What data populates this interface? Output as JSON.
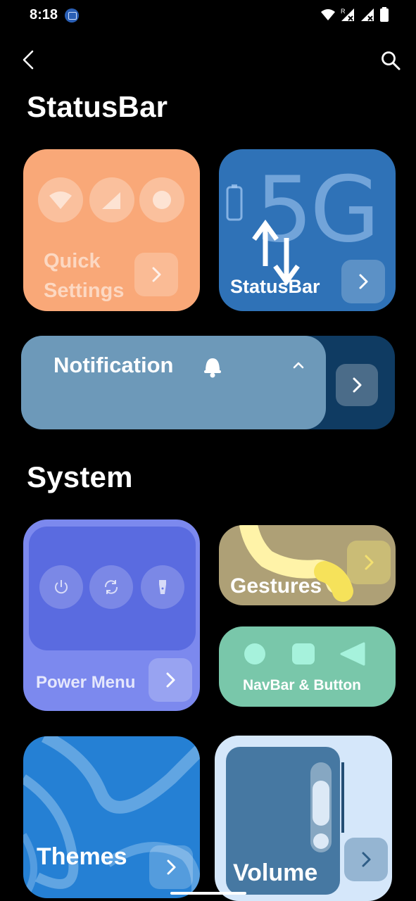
{
  "status_bar": {
    "time": "8:18",
    "icons": [
      "notification-image-icon",
      "wifi-icon",
      "signal-r-icon",
      "signal-icon",
      "battery-icon"
    ]
  },
  "topbar": {
    "back_icon": "back-arrow-icon",
    "search_icon": "search-icon"
  },
  "sections": {
    "statusbar_title": "StatusBar",
    "system_title": "System"
  },
  "cards": {
    "quick_settings": {
      "label": "Quick\nSettings",
      "color": "#f9a878"
    },
    "statusbar": {
      "label": "StatusBar",
      "big_text": "5G",
      "color": "#2f72b7"
    },
    "notification": {
      "label": "Notification",
      "color": "#6d99b9"
    },
    "power_menu": {
      "label": "Power Menu",
      "color": "#7c89ee"
    },
    "gestures": {
      "label": "Gestures",
      "color": "#aea076"
    },
    "navbar": {
      "label": "NavBar & Button",
      "color": "#79c7aa"
    },
    "themes": {
      "label": "Themes",
      "color": "#2580d4"
    },
    "volume": {
      "label": "Volume",
      "color": "#d5e7fa"
    }
  }
}
